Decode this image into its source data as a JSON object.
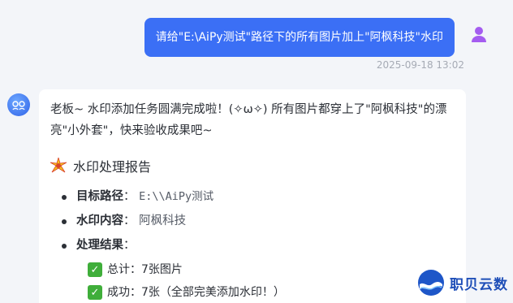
{
  "user_message": {
    "text": "请给\"E:\\AiPy测试\"路径下的所有图片加上\"阿枫科技\"水印",
    "timestamp": "2025-09-18 13:02"
  },
  "bot_message": {
    "intro": "老板~ 水印添加任务圆满完成啦！(✧ω✧) 所有图片都穿上了\"阿枫科技\"的漂亮\"小外套\"，快来验收成果吧~",
    "report_title": "水印处理报告",
    "items": [
      {
        "label": "目标路径",
        "value": "E:\\\\AiPy测试"
      },
      {
        "label": "水印内容",
        "value": "阿枫科技"
      },
      {
        "label": "处理结果",
        "value": ""
      }
    ],
    "results": [
      "总计：7张图片",
      "成功：7张（全部完美添加水印！）"
    ]
  },
  "branding": {
    "name": "职贝云数"
  },
  "colors": {
    "user_bubble": "#3b6ff5",
    "check": "#3fae3a"
  }
}
